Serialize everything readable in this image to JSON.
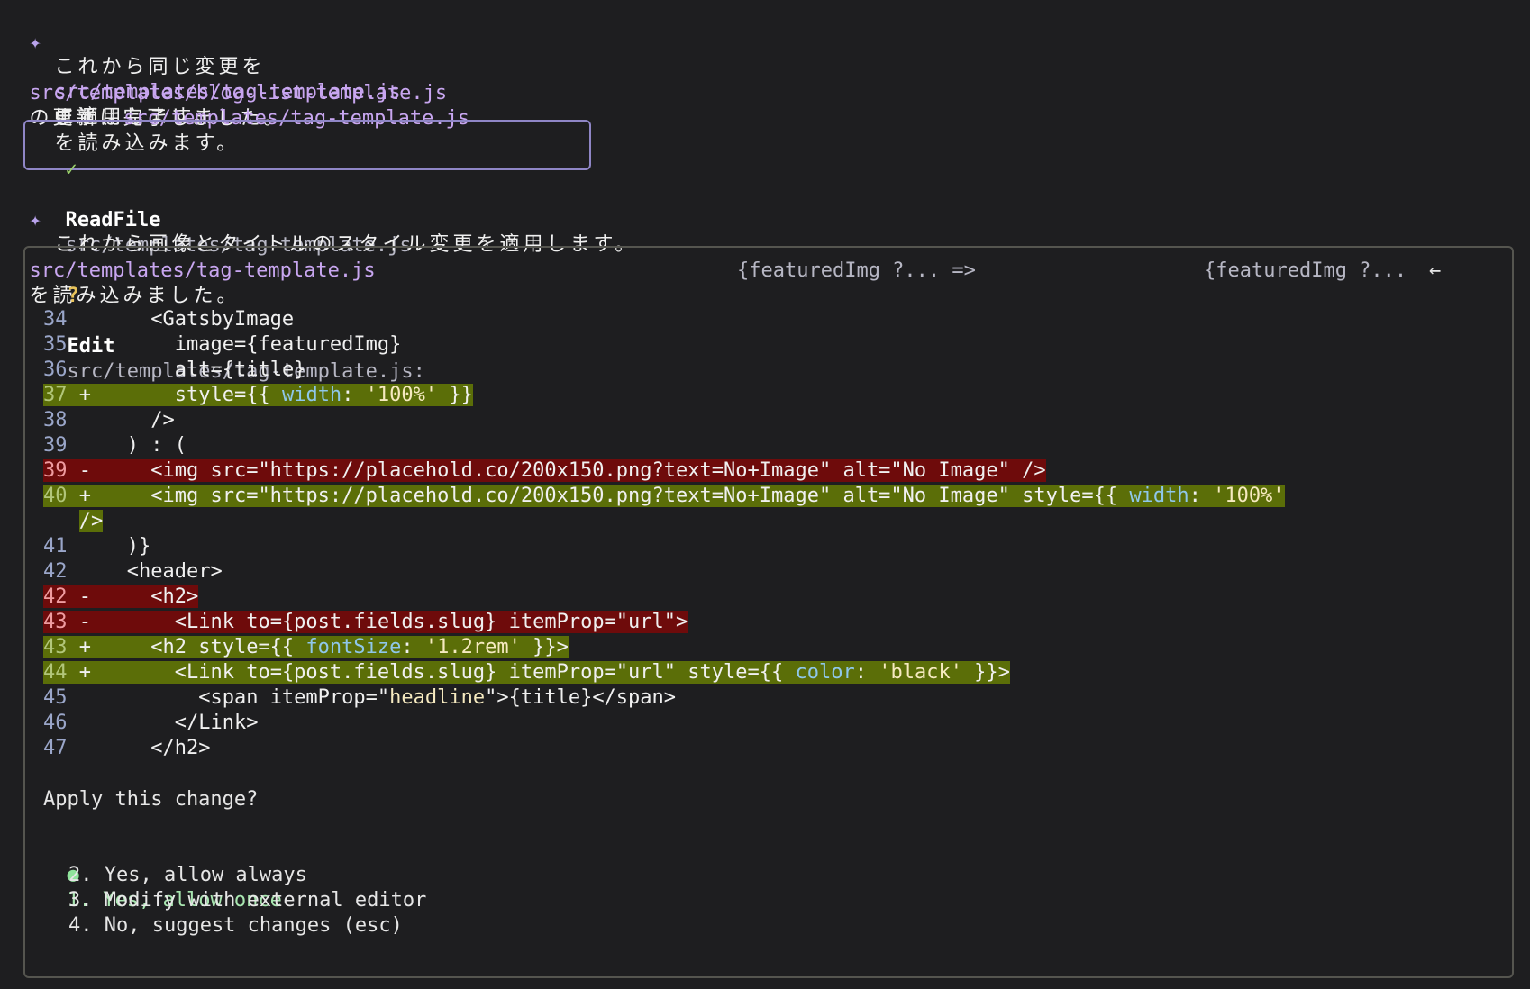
{
  "messages": {
    "m1_path": "src/templates/blog-list-template.js",
    "m1_text": "の更新は完了しました。",
    "m2_prefix": "これから同じ変更を",
    "m2_path": "src/templates/tag-template.js",
    "m2_suffix": "に適用します。",
    "m3_prefix": "まず、",
    "m3_path": "src/templates/tag-template.js",
    "m3_suffix": "を読み込みます。",
    "m4_path": "src/templates/tag-template.js",
    "m4_text": "を読み込みました。",
    "m5_text": "これから画像とタイトルのスタイル変更を適用します。"
  },
  "readfile": {
    "check": "✓",
    "label": "ReadFile",
    "path": "src/templates/tag-template.js"
  },
  "edit": {
    "q": "?",
    "label": "Edit",
    "path": "src/templates/tag-template.js:",
    "old": "{featuredImg ?... =>",
    "new": "{featuredImg ?...",
    "arrow": "←"
  },
  "diff": [
    {
      "n": "34",
      "m": "",
      "code": "<GatsbyImage"
    },
    {
      "n": "35",
      "m": "",
      "code": "image={featuredImg}"
    },
    {
      "n": "36",
      "m": "",
      "code": "alt={title}"
    },
    {
      "n": "37",
      "m": "+",
      "code_a": "style={{ ",
      "kw": "width",
      "code_b": ": ",
      "str": "'100%'",
      "code_c": " }}"
    },
    {
      "n": "38",
      "m": "",
      "code": "/>"
    },
    {
      "n": "39",
      "m": "",
      "code": ") : ("
    },
    {
      "n": "39",
      "m": "-",
      "code": "<img src=\"https://placehold.co/200x150.png?text=No+Image\" alt=\"No Image\" />"
    },
    {
      "n": "40",
      "m": "+",
      "code_a": "<img src=\"https://placehold.co/200x150.png?text=No+Image\" alt=\"No Image\" style={{ ",
      "kw": "width",
      "code_b": ": ",
      "str": "'100%'"
    },
    {
      "n": "",
      "m": "",
      "code": "/>"
    },
    {
      "n": "41",
      "m": "",
      "code": ")}"
    },
    {
      "n": "42",
      "m": "",
      "code": "<header>"
    },
    {
      "n": "42",
      "m": "-",
      "code": "<h2>"
    },
    {
      "n": "43",
      "m": "-",
      "code": "<Link to={post.fields.slug} itemProp=\"url\">"
    },
    {
      "n": "43",
      "m": "+",
      "code_a": "<h2 style={{ ",
      "kw": "fontSize",
      "code_b": ": ",
      "str": "'1.2rem'",
      "code_c": " }}>"
    },
    {
      "n": "44",
      "m": "+",
      "code_a": "<Link to={post.fields.slug} itemProp=\"url\" style={{ ",
      "kw": "color",
      "code_b": ": ",
      "str": "'black'",
      "code_c": " }}>"
    },
    {
      "n": "45",
      "m": "",
      "code_a": "<span itemProp=\"",
      "str": "headline",
      "code_c": "\">{title}</span>"
    },
    {
      "n": "46",
      "m": "",
      "code": "</Link>"
    },
    {
      "n": "47",
      "m": "",
      "code": "</h2>"
    }
  ],
  "prompt": "Apply this change?",
  "options": [
    {
      "label": "1. Yes, allow once",
      "selected": true
    },
    {
      "label": "2. Yes, allow always"
    },
    {
      "label": "3. Modify with external editor"
    },
    {
      "label": "4. No, suggest changes (esc)"
    }
  ],
  "star": "✦",
  "bullet": "●"
}
